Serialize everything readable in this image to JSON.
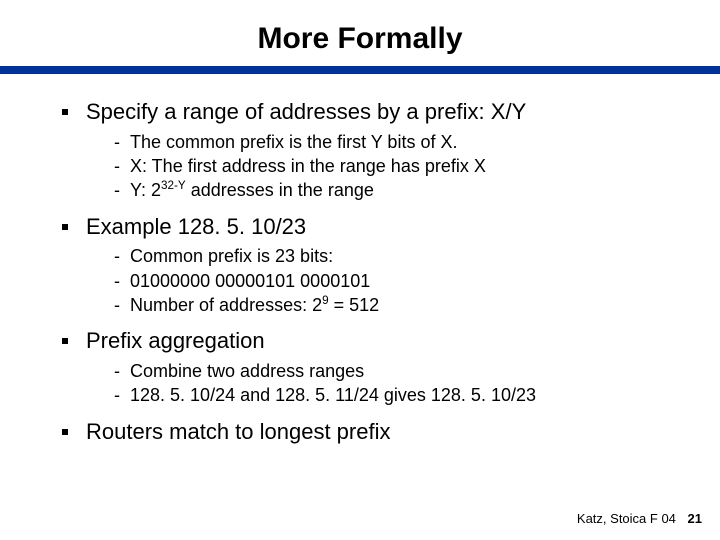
{
  "title": "More Formally",
  "bullets": [
    {
      "text": "Specify a range of addresses by a prefix: X/Y",
      "subs": [
        "The common prefix is the first Y bits of X.",
        "X: The first address in the range has prefix X",
        "Y: 2^{32-Y} addresses in the range"
      ]
    },
    {
      "text": "Example 128. 5. 10/23",
      "subs": [
        "Common prefix is 23 bits:",
        "01000000 00000101 0000101",
        "Number of addresses: 2^{9} = 512"
      ]
    },
    {
      "text": "Prefix aggregation",
      "subs": [
        "Combine two address ranges",
        "128. 5. 10/24 and 128. 5. 11/24 gives 128. 5. 10/23"
      ]
    },
    {
      "text": "Routers match to longest prefix",
      "subs": []
    }
  ],
  "footer": {
    "credit": "Katz, Stoica F 04",
    "page": "21"
  }
}
